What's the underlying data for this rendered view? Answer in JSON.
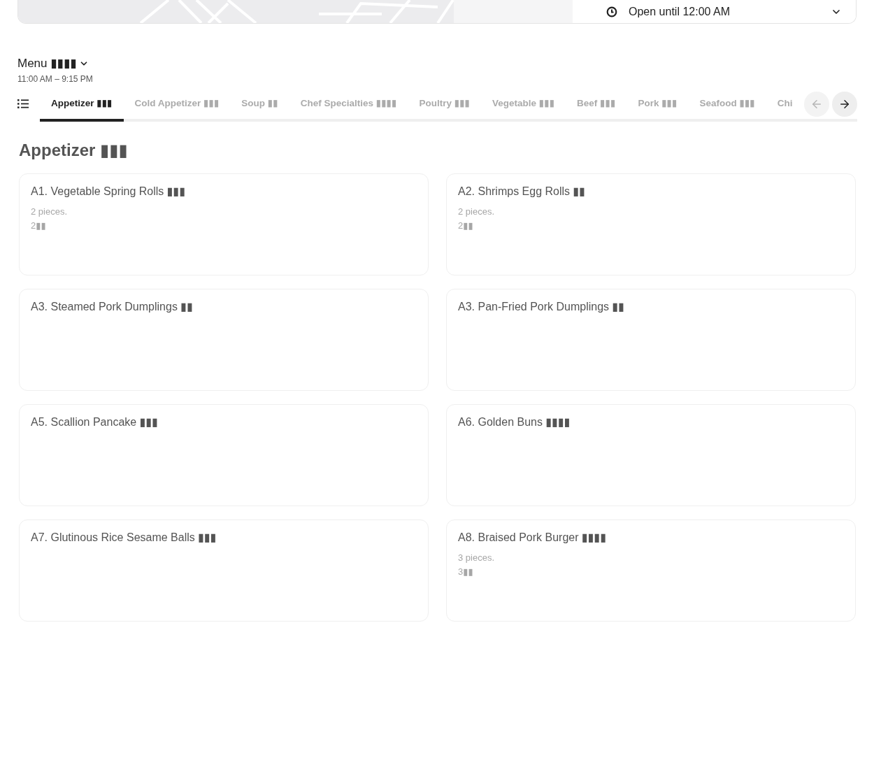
{
  "hours_panel": {
    "status": "Open until 12:00 AM"
  },
  "menu": {
    "title": "Menu ▮▮▮▮",
    "hours": "11:00 AM – 9:15 PM"
  },
  "category_tabs": [
    {
      "label": "Appetizer ▮▮▮",
      "selected": true
    },
    {
      "label": "Cold Appetizer ▮▮▮",
      "selected": false
    },
    {
      "label": "Soup ▮▮",
      "selected": false
    },
    {
      "label": "Chef Specialties ▮▮▮▮",
      "selected": false
    },
    {
      "label": "Poultry ▮▮▮",
      "selected": false
    },
    {
      "label": "Vegetable ▮▮▮",
      "selected": false
    },
    {
      "label": "Beef ▮▮▮",
      "selected": false
    },
    {
      "label": "Pork ▮▮▮",
      "selected": false
    },
    {
      "label": "Seafood ▮▮▮",
      "selected": false
    },
    {
      "label": "Chi",
      "selected": false
    }
  ],
  "scroll_buttons": [
    {
      "kind": "previous",
      "disabled": true
    },
    {
      "kind": "next",
      "disabled": false
    }
  ],
  "section": {
    "title": "Appetizer ▮▮▮",
    "items": [
      {
        "title": "A1. Vegetable Spring Rolls ▮▮▮",
        "details": [
          "2 pieces.",
          "2▮▮"
        ]
      },
      {
        "title": "A2. Shrimps Egg Rolls ▮▮",
        "details": [
          "2 pieces.",
          "2▮▮"
        ]
      },
      {
        "title": "A3. Steamed Pork Dumplings ▮▮"
      },
      {
        "title": "A3. Pan-Fried Pork Dumplings ▮▮"
      },
      {
        "title": "A5. Scallion Pancake ▮▮▮"
      },
      {
        "title": "A6. Golden Buns ▮▮▮▮"
      },
      {
        "title": "A7. Glutinous Rice Sesame Balls ▮▮▮"
      },
      {
        "title": "A8. Braised Pork Burger ▮▮▮▮",
        "details": [
          "3 pieces.",
          "3▮▮"
        ]
      }
    ]
  }
}
